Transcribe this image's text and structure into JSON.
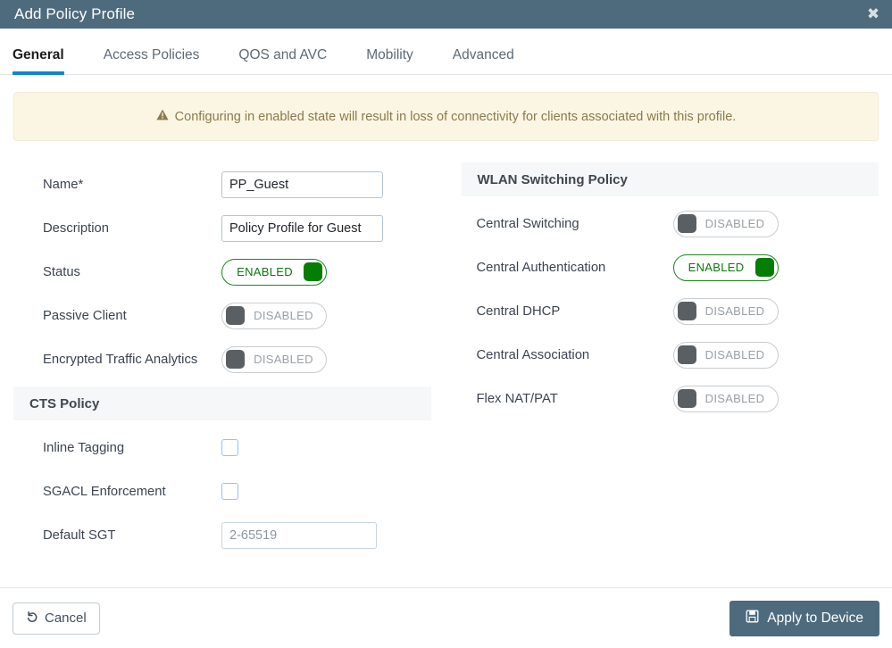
{
  "header": {
    "title": "Add Policy Profile",
    "close_icon": "close-icon"
  },
  "tabs": [
    {
      "label": "General",
      "active": true
    },
    {
      "label": "Access Policies",
      "active": false
    },
    {
      "label": "QOS and AVC",
      "active": false
    },
    {
      "label": "Mobility",
      "active": false
    },
    {
      "label": "Advanced",
      "active": false
    }
  ],
  "banner": {
    "icon": "warning-triangle-icon",
    "text": "Configuring in enabled state will result in loss of connectivity for clients associated with this profile."
  },
  "left": {
    "name": {
      "label": "Name*",
      "value": "PP_Guest",
      "placeholder": ""
    },
    "description": {
      "label": "Description",
      "value": "Policy Profile for Guest",
      "placeholder": ""
    },
    "status": {
      "label": "Status",
      "state": "ENABLED",
      "on": true
    },
    "passive_client": {
      "label": "Passive Client",
      "state": "DISABLED",
      "on": false
    },
    "encrypted_traffic_analytics": {
      "label": "Encrypted Traffic Analytics",
      "state": "DISABLED",
      "on": false
    },
    "cts_section_title": "CTS Policy",
    "inline_tagging": {
      "label": "Inline Tagging",
      "checked": false
    },
    "sgacl_enforcement": {
      "label": "SGACL Enforcement",
      "checked": false
    },
    "default_sgt": {
      "label": "Default SGT",
      "value": "",
      "placeholder": "2-65519"
    }
  },
  "right": {
    "wlan_section_title": "WLAN Switching Policy",
    "central_switching": {
      "label": "Central Switching",
      "state": "DISABLED",
      "on": false
    },
    "central_authentication": {
      "label": "Central Authentication",
      "state": "ENABLED",
      "on": true
    },
    "central_dhcp": {
      "label": "Central DHCP",
      "state": "DISABLED",
      "on": false
    },
    "central_association": {
      "label": "Central Association",
      "state": "DISABLED",
      "on": false
    },
    "flex_nat_pat": {
      "label": "Flex NAT/PAT",
      "state": "DISABLED",
      "on": false
    }
  },
  "footer": {
    "cancel_label": "Cancel",
    "cancel_icon": "undo-arrow-icon",
    "apply_label": "Apply to Device",
    "apply_icon": "save-disk-icon"
  },
  "colors": {
    "header_bg": "#4e6a7d",
    "tab_active_underline": "#0d88d0",
    "banner_bg": "#fbf6e3",
    "banner_text": "#8b7a4d",
    "toggle_on": "#047d04",
    "toggle_off": "#5a5f63",
    "section_bg": "#f6f7f8",
    "apply_bg": "#4e6a7d"
  }
}
